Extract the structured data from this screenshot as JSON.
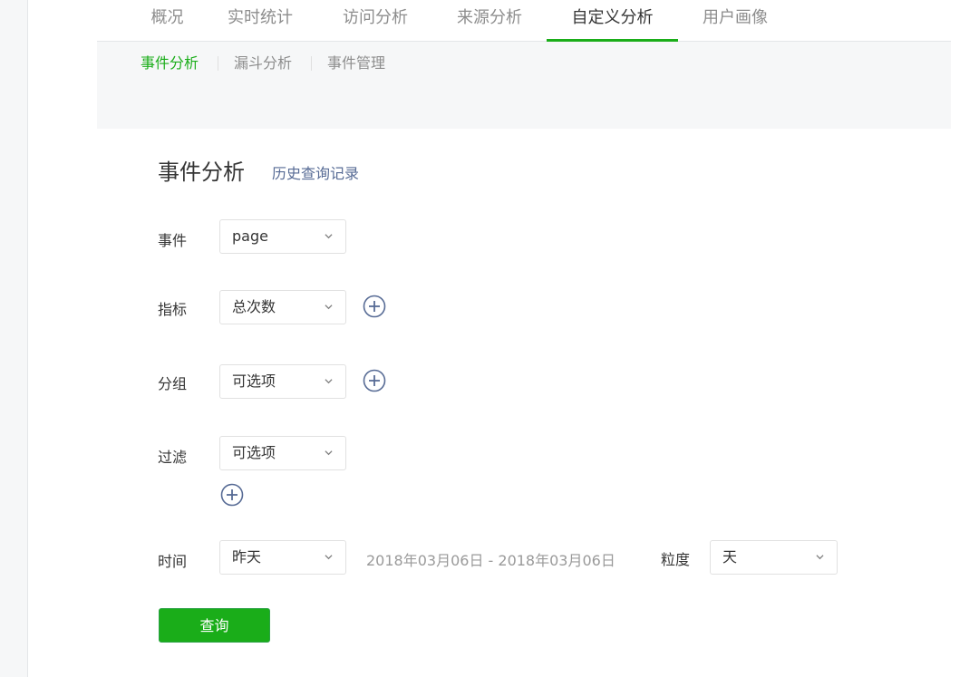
{
  "top_tabs": [
    {
      "label": "概况"
    },
    {
      "label": "实时统计"
    },
    {
      "label": "访问分析"
    },
    {
      "label": "来源分析"
    },
    {
      "label": "自定义分析",
      "active": true
    },
    {
      "label": "用户画像"
    }
  ],
  "sub_tabs": [
    {
      "label": "事件分析",
      "active": true
    },
    {
      "label": "漏斗分析"
    },
    {
      "label": "事件管理"
    }
  ],
  "page": {
    "title": "事件分析",
    "history_link": "历史查询记录"
  },
  "form": {
    "event": {
      "label": "事件",
      "value": "page"
    },
    "metric": {
      "label": "指标",
      "value": "总次数"
    },
    "group": {
      "label": "分组",
      "value": "可选项"
    },
    "filter": {
      "label": "过滤",
      "value": "可选项"
    },
    "time": {
      "label": "时间",
      "value": "昨天"
    },
    "date_range": "2018年03月06日 - 2018年03月06日",
    "granularity": {
      "label": "粒度",
      "value": "天"
    },
    "query_button": "查询"
  },
  "colors": {
    "accent": "#1aad19",
    "link": "#576b95",
    "icon": "#576b95"
  },
  "icons": {
    "dropdown": "chevron-down-icon",
    "add": "plus-circle-icon"
  }
}
